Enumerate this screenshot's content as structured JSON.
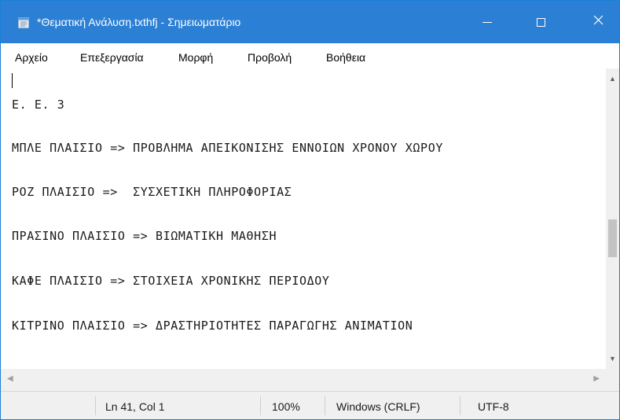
{
  "window": {
    "title": "*Θεματική Ανάλυση.txthfj - Σημειωματάριο",
    "title_bar_color": "#2b7fd4",
    "app_icon": "notepad-icon",
    "controls": {
      "minimize": "minimize-icon",
      "maximize": "maximize-icon",
      "close": "close-icon"
    }
  },
  "menu": {
    "items": [
      "Αρχείο",
      "Επεξεργασία",
      "Μορφή",
      "Προβολή",
      "Βοήθεια"
    ]
  },
  "editor": {
    "lines": [
      "Ε. Ε. 3",
      "ΜΠΛΕ ΠΛΑΙΣΙΟ => ΠΡΟΒΛΗΜΑ ΑΠΕΙΚΟΝΙΣΗΣ ΕΝΝΟΙΩΝ ΧΡΟΝΟΥ ΧΩΡΟΥ",
      "ΡΟΖ ΠΛΑΙΣΙΟ =>  ΣΥΣΧΕΤΙΚΗ ΠΛΗΡΟΦΟΡΙΑΣ",
      "ΠΡΑΣΙΝΟ ΠΛΑΙΣΙΟ => ΒΙΩΜΑΤΙΚΗ ΜΑΘΗΣΗ",
      "ΚΑΦΕ ΠΛΑΙΣΙΟ => ΣΤΟΙΧΕΙΑ ΧΡΟΝΙΚΗΣ ΠΕΡΙΟΔΟΥ",
      "ΚΙΤΡΙΝΟ ΠΛΑΙΣΙΟ => ΔΡΑΣΤΗΡΙΟΤΗΤΕΣ ΠΑΡΑΓΩΓΗΣ ΑΝΙΜΑΤΙΟΝ"
    ]
  },
  "status": {
    "position": "Ln 41, Col 1",
    "zoom": "100%",
    "line_ending": "Windows (CRLF)",
    "encoding": "UTF-8"
  }
}
